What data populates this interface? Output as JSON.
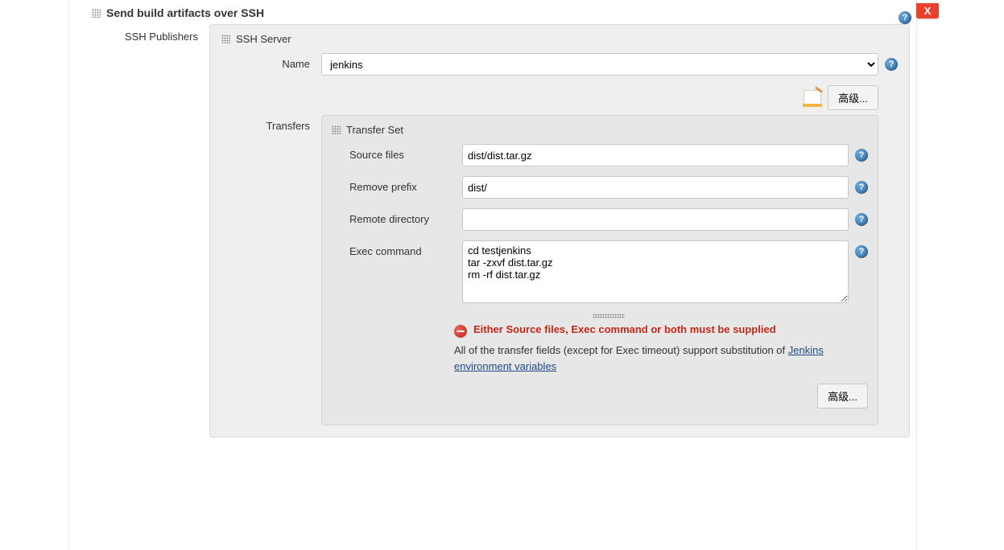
{
  "section_title": "Send build artifacts over SSH",
  "close_label": "X",
  "ssh_publishers_label": "SSH Publishers",
  "ssh_server": {
    "title": "SSH Server",
    "name_label": "Name",
    "name_value": "jenkins",
    "advanced_label": "高级..."
  },
  "transfers": {
    "label": "Transfers",
    "set_title": "Transfer Set",
    "source_files_label": "Source files",
    "source_files_value": "dist/dist.tar.gz",
    "remove_prefix_label": "Remove prefix",
    "remove_prefix_value": "dist/",
    "remote_dir_label": "Remote directory",
    "remote_dir_value": "",
    "exec_cmd_label": "Exec command",
    "exec_cmd_value": "cd testjenkins\ntar -zxvf dist.tar.gz\nrm -rf dist.tar.gz",
    "validation_msg": "Either Source files, Exec command or both must be supplied",
    "hint_prefix": "All of the transfer fields (except for Exec timeout) support substitution of ",
    "hint_link": "Jenkins environment variables",
    "advanced_label": "高级..."
  }
}
